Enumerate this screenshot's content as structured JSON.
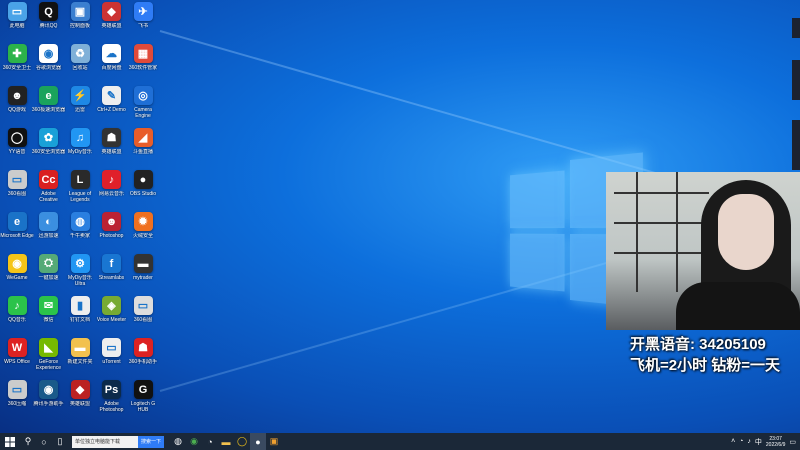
{
  "desktop": {
    "icons": [
      {
        "label": "此电脑",
        "color": "#4aa3e8",
        "glyph": "▭"
      },
      {
        "label": "腾讯QQ",
        "color": "#111",
        "glyph": "Q"
      },
      {
        "label": "控制面板",
        "color": "#3b7fd0",
        "glyph": "▣"
      },
      {
        "label": "英雄联盟",
        "color": "#c33",
        "glyph": "◆"
      },
      {
        "label": "飞书",
        "color": "#2f7cf6",
        "glyph": "✈"
      },
      {
        "label": "360安全卫士",
        "color": "#2cb34a",
        "glyph": "✚"
      },
      {
        "label": "谷歌浏览器",
        "color": "#fff",
        "glyph": "◉"
      },
      {
        "label": "回收站",
        "color": "#7fb0d8",
        "glyph": "♻"
      },
      {
        "label": "百度网盘",
        "color": "#fff",
        "glyph": "☁"
      },
      {
        "label": "360软件管家",
        "color": "#e04a3a",
        "glyph": "▦"
      },
      {
        "label": "QQ游戏",
        "color": "#222",
        "glyph": "☻"
      },
      {
        "label": "360极速浏览器",
        "color": "#1aa35c",
        "glyph": "e"
      },
      {
        "label": "迅雷",
        "color": "#1e88e5",
        "glyph": "⚡"
      },
      {
        "label": "Ctrl+Z Demo",
        "color": "#eee",
        "glyph": "✎"
      },
      {
        "label": "Camera Engine",
        "color": "#1f6fd6",
        "glyph": "◎"
      },
      {
        "label": "YY语音",
        "color": "#111",
        "glyph": "◯"
      },
      {
        "label": "360安全浏览器",
        "color": "#19a0d8",
        "glyph": "✿"
      },
      {
        "label": "MyDiy音乐",
        "color": "#2196f3",
        "glyph": "♫"
      },
      {
        "label": "英雄联盟",
        "color": "#333",
        "glyph": "☗"
      },
      {
        "label": "斗鱼直播",
        "color": "#e85d2a",
        "glyph": "◢"
      },
      {
        "label": "360看图",
        "color": "#ccc",
        "glyph": "▭"
      },
      {
        "label": "Adobe Creative",
        "color": "#d92020",
        "glyph": "Cc"
      },
      {
        "label": "League of Legends",
        "color": "#2a2a2a",
        "glyph": "L"
      },
      {
        "label": "网易云音乐",
        "color": "#e0202a",
        "glyph": "♪"
      },
      {
        "label": "OBS Studio",
        "color": "#222",
        "glyph": "●"
      },
      {
        "label": "Microsoft Edge",
        "color": "#1a73c8",
        "glyph": "e"
      },
      {
        "label": "迅游加速",
        "color": "#3b8fe0",
        "glyph": "◐"
      },
      {
        "label": "千牛卖家",
        "color": "#2a7fe0",
        "glyph": "◍"
      },
      {
        "label": "Photoshop",
        "color": "#b23",
        "glyph": "☻"
      },
      {
        "label": "火绒安全",
        "color": "#f07020",
        "glyph": "✹"
      },
      {
        "label": "WeGame",
        "color": "#f5c518",
        "glyph": "◉"
      },
      {
        "label": "一键加速",
        "color": "#5a7",
        "glyph": "⛭"
      },
      {
        "label": "MyDiy音乐 Ultra",
        "color": "#2196f3",
        "glyph": "⚙"
      },
      {
        "label": "Streamlabs",
        "color": "#1976d2",
        "glyph": "f"
      },
      {
        "label": "mytrader",
        "color": "#333",
        "glyph": "▬"
      },
      {
        "label": "QQ音乐",
        "color": "#2bc34a",
        "glyph": "♪"
      },
      {
        "label": "微信",
        "color": "#2bc34a",
        "glyph": "✉"
      },
      {
        "label": "钉钉文档",
        "color": "#eee",
        "glyph": "▮"
      },
      {
        "label": "Voice Meeter",
        "color": "#7a3",
        "glyph": "◈"
      },
      {
        "label": "360看图",
        "color": "#ddd",
        "glyph": "▭"
      },
      {
        "label": "WPS Office",
        "color": "#d22",
        "glyph": "W"
      },
      {
        "label": "GeForce Experience",
        "color": "#76b900",
        "glyph": "◣"
      },
      {
        "label": "新建文件夹",
        "color": "#f2c14e",
        "glyph": "▬"
      },
      {
        "label": "uTorrent",
        "color": "#eee",
        "glyph": "▭"
      },
      {
        "label": "360手机助手",
        "color": "#d22",
        "glyph": "☗"
      },
      {
        "label": "360压缩",
        "color": "#ccc",
        "glyph": "▭"
      },
      {
        "label": "腾讯手游助手",
        "color": "#1a5a8a",
        "glyph": "◉"
      },
      {
        "label": "英雄联盟",
        "color": "#b22",
        "glyph": "◆"
      },
      {
        "label": "Adobe Photoshop",
        "color": "#0c2a4a",
        "glyph": "Ps"
      },
      {
        "label": "Logitech G HUB",
        "color": "#111",
        "glyph": "G"
      }
    ]
  },
  "overlay": {
    "line1": "开黑语音: 34205109",
    "line2": "飞机=2小时 钻粉=一天"
  },
  "taskbar": {
    "start_icon": "windows-start-icon",
    "search_text": "单位独立电脑能下载",
    "search_btn": "搜索一下",
    "apps": [
      "edge-icon",
      "chrome-icon",
      "wechat-icon",
      "folder-icon",
      "yy-icon",
      "obs-icon",
      "app-icon"
    ],
    "clock_time": "23:07",
    "clock_date": "2022/6/9"
  }
}
